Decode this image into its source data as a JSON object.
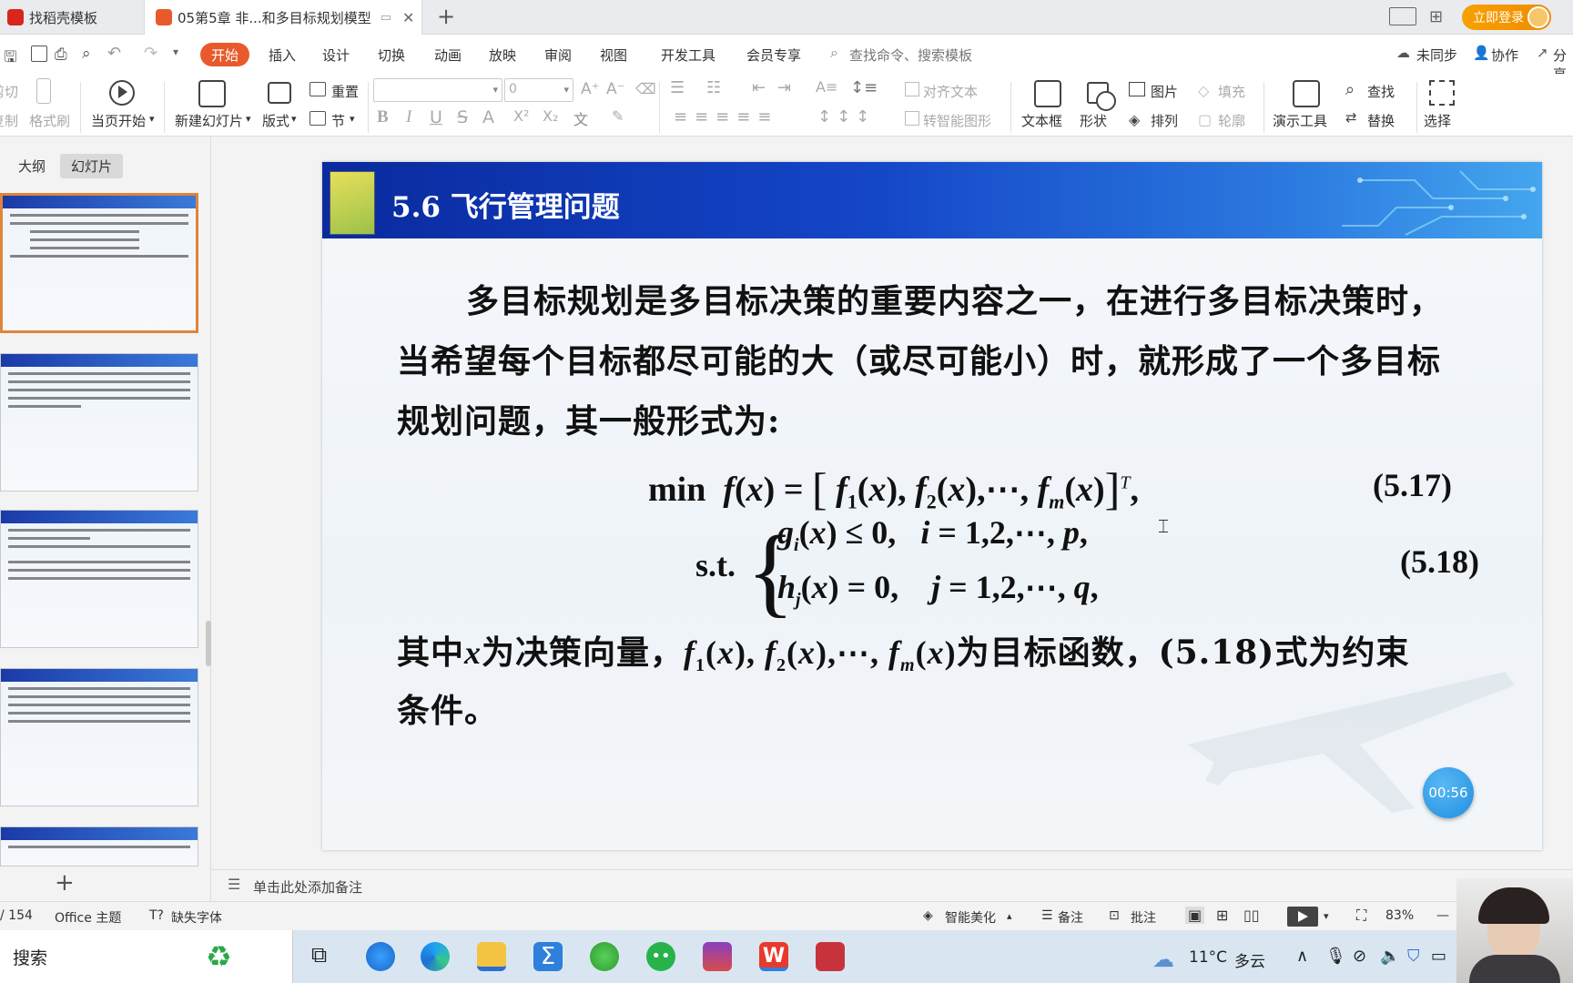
{
  "tabs": [
    {
      "label": "找稻壳模板"
    },
    {
      "label": "05第5章  非...和多目标规划模型"
    }
  ],
  "title_bar": {
    "login_label": "立即登录"
  },
  "menu": {
    "items": [
      "开始",
      "插入",
      "设计",
      "切换",
      "动画",
      "放映",
      "审阅",
      "视图",
      "开发工具",
      "会员专享"
    ],
    "search_placeholder": "查找命令、搜索模板",
    "sync": "未同步",
    "collab": "协作",
    "share": "分享"
  },
  "ribbon": {
    "cut": "剪切",
    "copy": "复制",
    "format_painter": "格式刷",
    "from_current": "当页开始",
    "new_slide": "新建幻灯片",
    "layout": "版式",
    "reset": "重置",
    "section": "节",
    "font_size": "0",
    "align_text": "对齐文本",
    "smart_shape": "转智能图形",
    "textbox": "文本框",
    "shape": "形状",
    "picture": "图片",
    "fill": "填充",
    "arrange": "排列",
    "outline": "轮廓",
    "present_tools": "演示工具",
    "find": "查找",
    "replace": "替换",
    "select": "选择"
  },
  "panel": {
    "tab_outline": "大纲",
    "tab_slides": "幻灯片"
  },
  "slide": {
    "title": "5.6 飞行管理问题",
    "para1_line1": "多目标规划是多目标决策的重要内容之一，在进行多目标决策时，",
    "para1_line2": "当希望每个目标都尽可能的大（或尽可能小）时，就形成了一个多目标",
    "para1_line3": "规划问题，其一般形式为:",
    "eq1_number": "(5.17)",
    "eq2_number": "(5.18)",
    "para2_prefix": "其中",
    "para2_mid1": "为决策向量，",
    "para2_mid2": "为目标函数，(5.18)式为约束",
    "para2_line2": "条件。"
  },
  "timer": "00:56",
  "notes": {
    "placeholder": "单击此处添加备注"
  },
  "status": {
    "page": "/ 154",
    "theme": "Office 主题",
    "missing_font": "缺失字体",
    "beautify": "智能美化",
    "notes_btn": "备注",
    "comment_btn": "批注",
    "zoom": "83%"
  },
  "taskbar": {
    "search": "搜索",
    "weather_temp": "11°C",
    "weather_text": "多云"
  },
  "colors": {
    "accent_orange": "#e85a2c",
    "header_blue": "#1446c8",
    "login_orange": "#f7a100"
  }
}
